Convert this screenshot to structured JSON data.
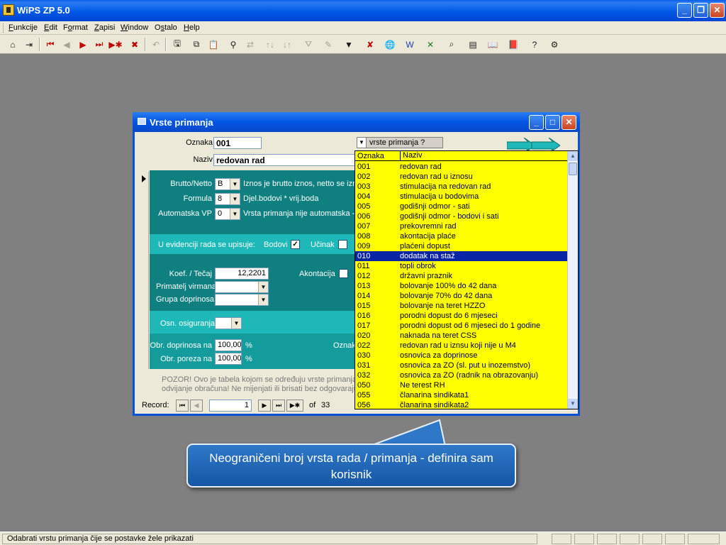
{
  "app": {
    "title": "WiPS ZP 5.0",
    "window_buttons": {
      "minimize": "_",
      "restore": "❐",
      "close": "✕"
    }
  },
  "menu": [
    {
      "label": "Funkcije",
      "key": "F",
      "rest": "unkcije"
    },
    {
      "label": "Edit",
      "key": "E",
      "rest": "dit"
    },
    {
      "label": "Format",
      "key": "o",
      "pre": "F",
      "rest": "rmat"
    },
    {
      "label": "Zapisi",
      "key": "Z",
      "rest": "apisi"
    },
    {
      "label": "Window",
      "key": "W",
      "rest": "indow"
    },
    {
      "label": "Ostalo",
      "key": "s",
      "pre": "O",
      "rest": "talo"
    },
    {
      "label": "Help",
      "key": "H",
      "rest": "elp"
    }
  ],
  "form": {
    "title": "Vrste primanja",
    "oznaka_label": "Oznaka",
    "oznaka_value": "001",
    "naziv_label": "Naziv",
    "naziv_value": "redovan rad",
    "combo_hint": "vrste primanja ?",
    "brutto_label": "Brutto/Netto",
    "brutto_value": "B",
    "brutto_desc": "Iznos je brutto iznos, netto se izrac",
    "formula_label": "Formula",
    "formula_value": "8",
    "formula_desc": "Djel.bodovi * vrij.boda",
    "automatska_label": "Automatska VP",
    "automatska_value": "0",
    "automatska_desc": "Vrsta primanja nije automatska - u",
    "evidencija_label": "U evidenciji rada se upisuje:",
    "bodovi_label": "Bodovi",
    "bodovi_checked": "✓",
    "ucinak_label": "Učinak",
    "koef_label": "Koef. / Tečaj",
    "koef_value": "12,2201",
    "akontacija_label": "Akontacija",
    "primatelj_label": "Primatelj virmana",
    "grupa_label": "Grupa doprinosa",
    "osn_label": "Osn. osiguranja",
    "obr_dop_label": "Obr. doprinosa na",
    "obr_dop_value": "100,00",
    "obr_por_label": "Obr. poreza na",
    "obr_por_value": "100,00",
    "percent": "%",
    "oznak_right": "Oznak",
    "note_line1": "POZOR!  Ovo je tabela kojom se određuju vrste primanja t",
    "note_line2": "odvijanje obračuna!  Ne mijenjati ili brisati bez odgovarajuć",
    "record_label": "Record:",
    "record_current": "1",
    "record_of": "of",
    "record_total": "33"
  },
  "dropdown": {
    "col_oznaka": "Oznaka",
    "col_naziv": "Naziv",
    "selected_index": 9,
    "rows": [
      {
        "code": "001",
        "name": "redovan rad"
      },
      {
        "code": "002",
        "name": "redovan rad u iznosu"
      },
      {
        "code": "003",
        "name": "stimulacija na redovan rad"
      },
      {
        "code": "004",
        "name": "stimulacija u bodovima"
      },
      {
        "code": "005",
        "name": "godišnji odmor - sati"
      },
      {
        "code": "006",
        "name": "godišnji odmor - bodovi i sati"
      },
      {
        "code": "007",
        "name": "prekovremni rad"
      },
      {
        "code": "008",
        "name": "akontacija plaće"
      },
      {
        "code": "009",
        "name": "plaćeni dopust"
      },
      {
        "code": "010",
        "name": "dodatak na staž"
      },
      {
        "code": "011",
        "name": "topli obrok"
      },
      {
        "code": "012",
        "name": "državni praznik"
      },
      {
        "code": "013",
        "name": "bolovanje 100% do 42 dana"
      },
      {
        "code": "014",
        "name": "bolovanje 70% do 42 dana"
      },
      {
        "code": "015",
        "name": "bolovanje na teret HZZO"
      },
      {
        "code": "016",
        "name": "porodni dopust do 6 mjeseci"
      },
      {
        "code": "017",
        "name": "porodni dopust od 6 mjeseci do 1 godine"
      },
      {
        "code": "020",
        "name": "naknada na teret CSS"
      },
      {
        "code": "022",
        "name": "redovan rad u iznsu koji nije u M4"
      },
      {
        "code": "030",
        "name": "osnovica za doprinose"
      },
      {
        "code": "031",
        "name": "osnovica za ZO (sl. put u inozemstvo)"
      },
      {
        "code": "032",
        "name": "osnovica za ZO (radnik na obrazovanju)"
      },
      {
        "code": "050",
        "name": "Ne terest RH"
      },
      {
        "code": "055",
        "name": "članarina sindikata1"
      },
      {
        "code": "056",
        "name": "članarina  sindikata2"
      }
    ]
  },
  "callout": {
    "line1": "Neograničeni broj vrsta rada / primanja - definira sam",
    "line2": "korisnik"
  },
  "status": {
    "text": "Odabrati vrstu primanja čije se postavke žele prikazati"
  },
  "toolbar_icons": [
    "home-icon",
    "exit-icon",
    "first-record-icon",
    "prev-record-icon",
    "next-record-icon",
    "last-record-icon",
    "new-record-icon",
    "delete-record-icon",
    "undo-icon",
    "save-icon",
    "copy-icon",
    "paste-icon",
    "find-icon",
    "replace-icon",
    "sort-ascending-icon",
    "sort-descending-icon",
    "filter-icon",
    "edit-filter-icon",
    "apply-filter-icon",
    "remove-filter-icon",
    "globe-icon",
    "word-icon",
    "excel-icon",
    "report-icon",
    "print-preview-icon",
    "book-icon",
    "manual-icon",
    "help-icon",
    "settings-icon"
  ],
  "colors": {
    "title_blue": "#0058e6",
    "teal_dark": "#0f7f7f",
    "teal_light": "#1fb8b8",
    "dropdown_yellow": "#ffff00",
    "selection": "#0a24a6"
  }
}
